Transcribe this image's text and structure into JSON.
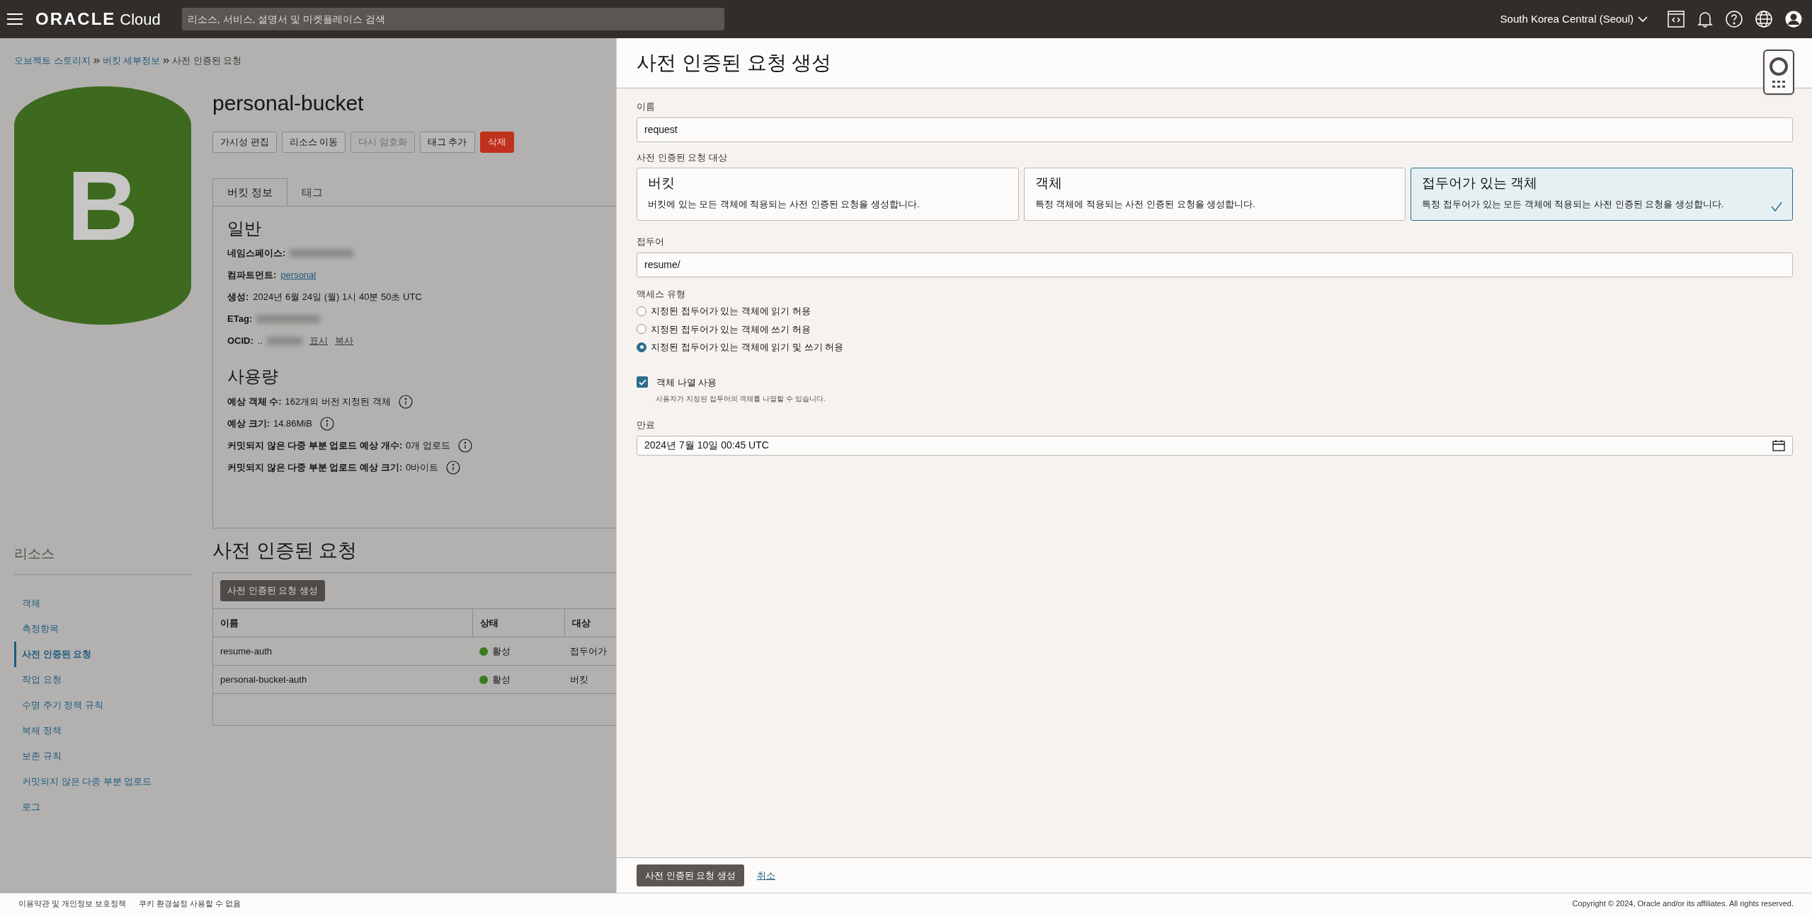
{
  "top_bar": {
    "brand": "ORACLE",
    "brand_suffix": "Cloud",
    "search": {
      "placeholder": "리소스, 서비스, 설명서 및 마켓플레이스 검색"
    },
    "region": "South Korea Central (Seoul)"
  },
  "breadcrumb": [
    {
      "label": "오브젝트 스토리지",
      "link": true
    },
    {
      "label": "버킷 세부정보",
      "link": true
    },
    {
      "label": "사전 인증된 요청",
      "link": false
    }
  ],
  "bucket": {
    "icon_letter": "B",
    "title": "personal-bucket",
    "actions": [
      {
        "label": "가시성 편집",
        "kind": "default",
        "disabled": false
      },
      {
        "label": "리소스 이동",
        "kind": "default",
        "disabled": false
      },
      {
        "label": "다시 암호화",
        "kind": "default",
        "disabled": true
      },
      {
        "label": "태그 추가",
        "kind": "default",
        "disabled": false
      },
      {
        "label": "삭제",
        "kind": "danger",
        "disabled": false
      }
    ],
    "tabs": [
      {
        "label": "버킷 정보",
        "selected": true
      },
      {
        "label": "태그",
        "selected": false
      }
    ],
    "general": {
      "heading": "일반",
      "fields": [
        {
          "label": "네임스페이스:",
          "kind": "redacted"
        },
        {
          "label": "컴파트먼트:",
          "kind": "link",
          "value": "personal"
        },
        {
          "label": "생성:",
          "kind": "text",
          "value": "2024년 6월 24일 (월) 1시 40분 50초 UTC"
        },
        {
          "label": "ETag:",
          "kind": "redacted"
        },
        {
          "label": "OCID:",
          "kind": "ocid",
          "value": "..",
          "links": [
            "표시",
            "복사"
          ]
        }
      ]
    },
    "usage": {
      "heading": "사용량",
      "fields": [
        {
          "label": "예상 객체 수:",
          "value": "162개의 버전 지정된 객체"
        },
        {
          "label": "예상 크기:",
          "value": "14.86MiB"
        },
        {
          "label": "커밋되지 않은 다중 부분 업로드 예상 개수:",
          "value": "0개 업로드"
        },
        {
          "label": "커밋되지 않은 다중 부분 업로드 예상 크기:",
          "value": "0바이트"
        }
      ]
    }
  },
  "resources": {
    "heading": "리소스",
    "items": [
      {
        "label": "객체",
        "selected": false
      },
      {
        "label": "측정항목",
        "selected": false
      },
      {
        "label": "사전 인증된 요청",
        "selected": true
      },
      {
        "label": "작업 요청",
        "selected": false
      },
      {
        "label": "수명 주기 정책 규칙",
        "selected": false
      },
      {
        "label": "복제 정책",
        "selected": false
      },
      {
        "label": "보존 규칙",
        "selected": false
      },
      {
        "label": "커밋되지 않은 다중 부분 업로드",
        "selected": false
      },
      {
        "label": "로그",
        "selected": false
      }
    ]
  },
  "requests": {
    "heading": "사전 인증된 요청",
    "create_button": "사전 인증된 요청 생성",
    "columns": [
      "이름",
      "상태",
      "대상"
    ],
    "rows": [
      {
        "name": "resume-auth",
        "status": "활성",
        "color": "#3b7a1e",
        "target": "접두어가"
      },
      {
        "name": "personal-bucket-auth",
        "status": "활성",
        "color": "#3b7a1e",
        "target": "버킷"
      }
    ]
  },
  "drawer": {
    "title": "사전 인증된 요청 생성",
    "name": {
      "label": "이름",
      "value": "request"
    },
    "target": {
      "label": "사전 인증된 요청 대상",
      "options": [
        {
          "title": "버킷",
          "description": "버킷에 있는 모든 객체에 적용되는 사전 인증된 요청을 생성합니다.",
          "selected": false
        },
        {
          "title": "객체",
          "description": "특정 객체에 적용되는 사전 인증된 요청을 생성합니다.",
          "selected": false
        },
        {
          "title": "접두어가 있는 객체",
          "description": "특정 접두어가 있는 모든 객체에 적용되는 사전 인증된 요청을 생성합니다.",
          "selected": true
        }
      ]
    },
    "prefix": {
      "label": "접두어",
      "value": "resume/"
    },
    "access": {
      "label": "액세스 유형",
      "options": [
        {
          "label": "지정된 접두어가 있는 객체에 읽기 허용",
          "selected": false
        },
        {
          "label": "지정된 접두어가 있는 객체에 쓰기 허용",
          "selected": false
        },
        {
          "label": "지정된 접두어가 있는 객체에 읽기 및 쓰기 허용",
          "selected": true
        }
      ]
    },
    "list_objects": {
      "label": "객체 나열 사용",
      "help": "사용자가 지정된 접두어의 객체를 나열할 수 있습니다.",
      "checked": true
    },
    "expiry": {
      "label": "만료",
      "value": "2024년 7월 10일 00:45 UTC"
    },
    "submit": "사전 인증된 요청 생성",
    "cancel": "취소"
  },
  "footer": {
    "links": [
      "이용약관 및 개인정보 보호정책",
      "쿠키 환경설정 사용할 수 없음"
    ],
    "copyright": "Copyright © 2024, Oracle and/or its affiliates. All rights reserved."
  }
}
